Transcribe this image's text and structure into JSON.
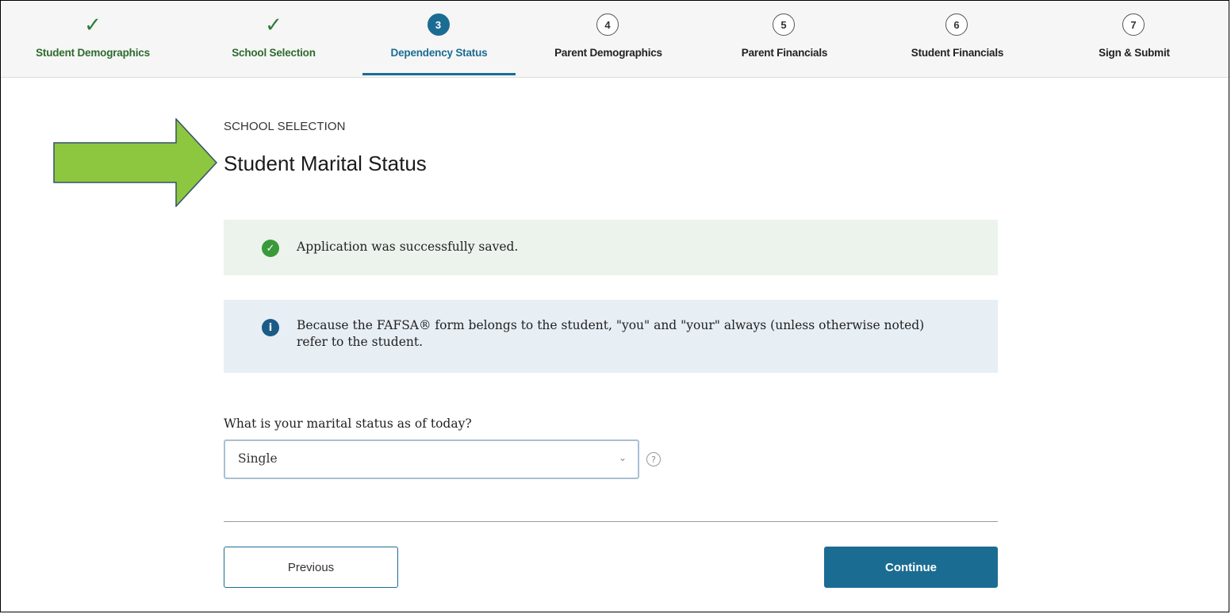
{
  "stepper": {
    "steps": [
      {
        "number": "1",
        "label": "Student Demographics",
        "state": "complete"
      },
      {
        "number": "2",
        "label": "School Selection",
        "state": "complete"
      },
      {
        "number": "3",
        "label": "Dependency Status",
        "state": "current"
      },
      {
        "number": "4",
        "label": "Parent Demographics",
        "state": "upcoming"
      },
      {
        "number": "5",
        "label": "Parent Financials",
        "state": "upcoming"
      },
      {
        "number": "6",
        "label": "Student Financials",
        "state": "upcoming"
      },
      {
        "number": "7",
        "label": "Sign & Submit",
        "state": "upcoming"
      }
    ],
    "complete_icon": "checkmark-icon"
  },
  "annotation": {
    "icon": "arrow-right-icon",
    "color": "#8dc63f"
  },
  "section_label": "SCHOOL SELECTION",
  "page_title": "Student Marital Status",
  "alerts": {
    "success": {
      "icon": "check-circle-icon",
      "text": "Application was successfully saved."
    },
    "info": {
      "icon": "info-circle-icon",
      "text": "Because the FAFSA® form belongs to the student, \"you\" and \"your\" always (unless otherwise noted) refer to the student."
    }
  },
  "question": {
    "label": "What is your marital status as of today?",
    "selected": "Single",
    "help_icon": "question-circle-icon"
  },
  "buttons": {
    "previous": "Previous",
    "continue": "Continue"
  },
  "colors": {
    "primary": "#1b6c93",
    "success": "#3a9a3a",
    "complete_text": "#2e6b2e"
  }
}
